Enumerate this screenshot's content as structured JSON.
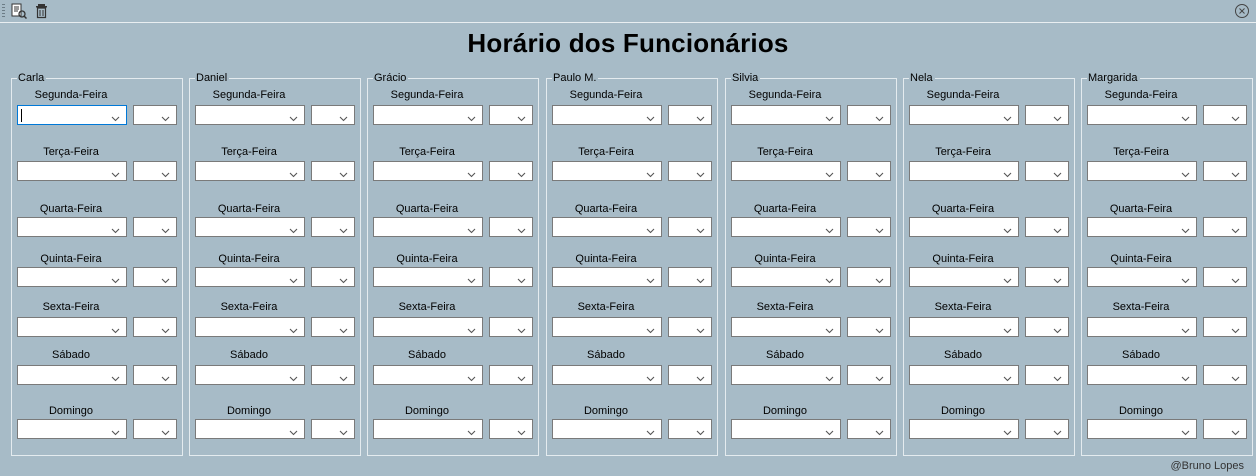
{
  "toolbar": {
    "icons": [
      "print-preview-icon",
      "trash-icon",
      "close-circle-icon"
    ]
  },
  "title": "Horário dos Funcionários",
  "days": [
    "Segunda-Feira",
    "Terça-Feira",
    "Quarta-Feira",
    "Quinta-Feira",
    "Sexta-Feira",
    "Sábado",
    "Domingo"
  ],
  "employees": [
    {
      "name": "Carla"
    },
    {
      "name": "Daniel"
    },
    {
      "name": "Grácio"
    },
    {
      "name": "Paulo M."
    },
    {
      "name": "Silvia"
    },
    {
      "name": "Nela"
    },
    {
      "name": "Margarida"
    }
  ],
  "footer": "@Bruno Lopes"
}
